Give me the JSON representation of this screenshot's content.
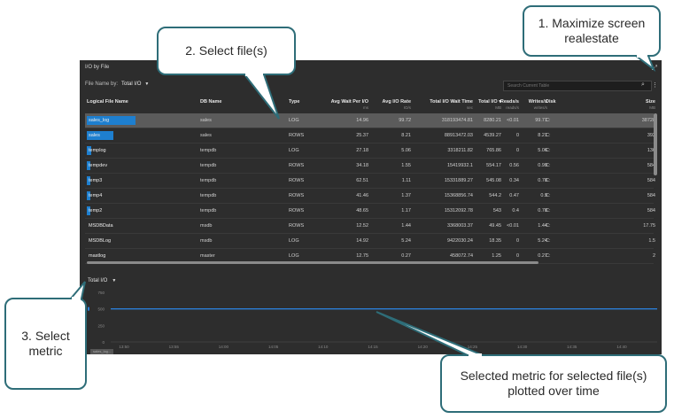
{
  "panel": {
    "title": "I/O by File",
    "file_name_by_label": "File Name by:",
    "file_name_by_value": "Total I/O",
    "search_placeholder": "Search Current Table"
  },
  "columns": [
    {
      "label": "Logical File Name",
      "unit": ""
    },
    {
      "label": "DB Name",
      "unit": ""
    },
    {
      "label": "Type",
      "unit": ""
    },
    {
      "label": "Avg Wait Per I/O",
      "unit": "ms"
    },
    {
      "label": "Avg I/O Rate",
      "unit": "IO/s"
    },
    {
      "label": "Total I/O Wait Time",
      "unit": "sec"
    },
    {
      "label": "Total I/O ▾",
      "unit": "MB"
    },
    {
      "label": "Reads/s",
      "unit": "reads/s"
    },
    {
      "label": "Writes/s",
      "unit": "writes/s"
    },
    {
      "label": "Disk",
      "unit": ""
    },
    {
      "label": "Size",
      "unit": "MB"
    }
  ],
  "rows": [
    {
      "name": "sales_log",
      "db": "sales",
      "type": "LOG",
      "wait": "14.96",
      "rate": "99.72",
      "total_wait": "318193474.81",
      "total_io": "8280.21",
      "reads": "<0.01",
      "writes": "99.71",
      "disk": "C:",
      "size": "38728",
      "share": 0.55,
      "selected": true
    },
    {
      "name": "sales",
      "db": "sales",
      "type": "ROWS",
      "wait": "25.37",
      "rate": "8.21",
      "total_wait": "88913472.03",
      "total_io": "4539.27",
      "reads": "0",
      "writes": "8.21",
      "disk": "C:",
      "size": "392",
      "share": 0.3,
      "selected": false
    },
    {
      "name": "templog",
      "db": "tempdb",
      "type": "LOG",
      "wait": "27.18",
      "rate": "5.06",
      "total_wait": "3318211.82",
      "total_io": "765.86",
      "reads": "0",
      "writes": "5.06",
      "disk": "C:",
      "size": "136",
      "share": 0.05,
      "selected": false
    },
    {
      "name": "tempdev",
      "db": "tempdb",
      "type": "ROWS",
      "wait": "34.18",
      "rate": "1.55",
      "total_wait": "15419932.1",
      "total_io": "554.17",
      "reads": "0.56",
      "writes": "0.99",
      "disk": "C:",
      "size": "584",
      "share": 0.035,
      "selected": false
    },
    {
      "name": "temp3",
      "db": "tempdb",
      "type": "ROWS",
      "wait": "62.51",
      "rate": "1.11",
      "total_wait": "15331889.27",
      "total_io": "545.08",
      "reads": "0.34",
      "writes": "0.78",
      "disk": "C:",
      "size": "584",
      "share": 0.035,
      "selected": false
    },
    {
      "name": "temp4",
      "db": "tempdb",
      "type": "ROWS",
      "wait": "41.46",
      "rate": "1.37",
      "total_wait": "15368856.74",
      "total_io": "544.2",
      "reads": "0.47",
      "writes": "0.9",
      "disk": "C:",
      "size": "584",
      "share": 0.035,
      "selected": false
    },
    {
      "name": "temp2",
      "db": "tempdb",
      "type": "ROWS",
      "wait": "48.65",
      "rate": "1.17",
      "total_wait": "15312092.78",
      "total_io": "543",
      "reads": "0.4",
      "writes": "0.78",
      "disk": "C:",
      "size": "584",
      "share": 0.035,
      "selected": false
    },
    {
      "name": "MSDBData",
      "db": "msdb",
      "type": "ROWS",
      "wait": "12.52",
      "rate": "1.44",
      "total_wait": "3368003.37",
      "total_io": "49.45",
      "reads": "<0.01",
      "writes": "1.44",
      "disk": "C:",
      "size": "17.75",
      "share": 0,
      "selected": false
    },
    {
      "name": "MSDBLog",
      "db": "msdb",
      "type": "LOG",
      "wait": "14.92",
      "rate": "5.24",
      "total_wait": "9422030.24",
      "total_io": "18.35",
      "reads": "0",
      "writes": "5.24",
      "disk": "C:",
      "size": "1.5",
      "share": 0,
      "selected": false
    },
    {
      "name": "mastlog",
      "db": "master",
      "type": "LOG",
      "wait": "12.75",
      "rate": "0.27",
      "total_wait": "458072.74",
      "total_io": "1.25",
      "reads": "0",
      "writes": "0.27",
      "disk": "C:",
      "size": "2",
      "share": 0,
      "selected": false
    }
  ],
  "metric_selector": "Total I/O",
  "chart_data": {
    "type": "line",
    "y_ticks": [
      "750",
      "500",
      "250",
      "0"
    ],
    "ylim": [
      0,
      750
    ],
    "x_ticks": [
      "13:50",
      "13:55",
      "14:00",
      "14:05",
      "14:10",
      "14:15",
      "14:20",
      "14:25",
      "14:30",
      "14:35",
      "14:40"
    ],
    "series": [
      {
        "values": [
          500,
          500,
          500,
          500,
          500,
          500,
          500,
          500,
          500,
          500,
          500,
          500
        ]
      }
    ],
    "legend_text": "sales_log..."
  },
  "colors": {
    "panel_bg": "#2d2d2d",
    "accent": "#1e7fcf",
    "callout_border": "#2e6d78"
  },
  "callouts": {
    "maximize": "1. Maximize screen realestate",
    "select_files": "2. Select file(s)",
    "select_metric": "3. Select metric",
    "selected_metric": "Selected metric for selected file(s) plotted over time"
  }
}
